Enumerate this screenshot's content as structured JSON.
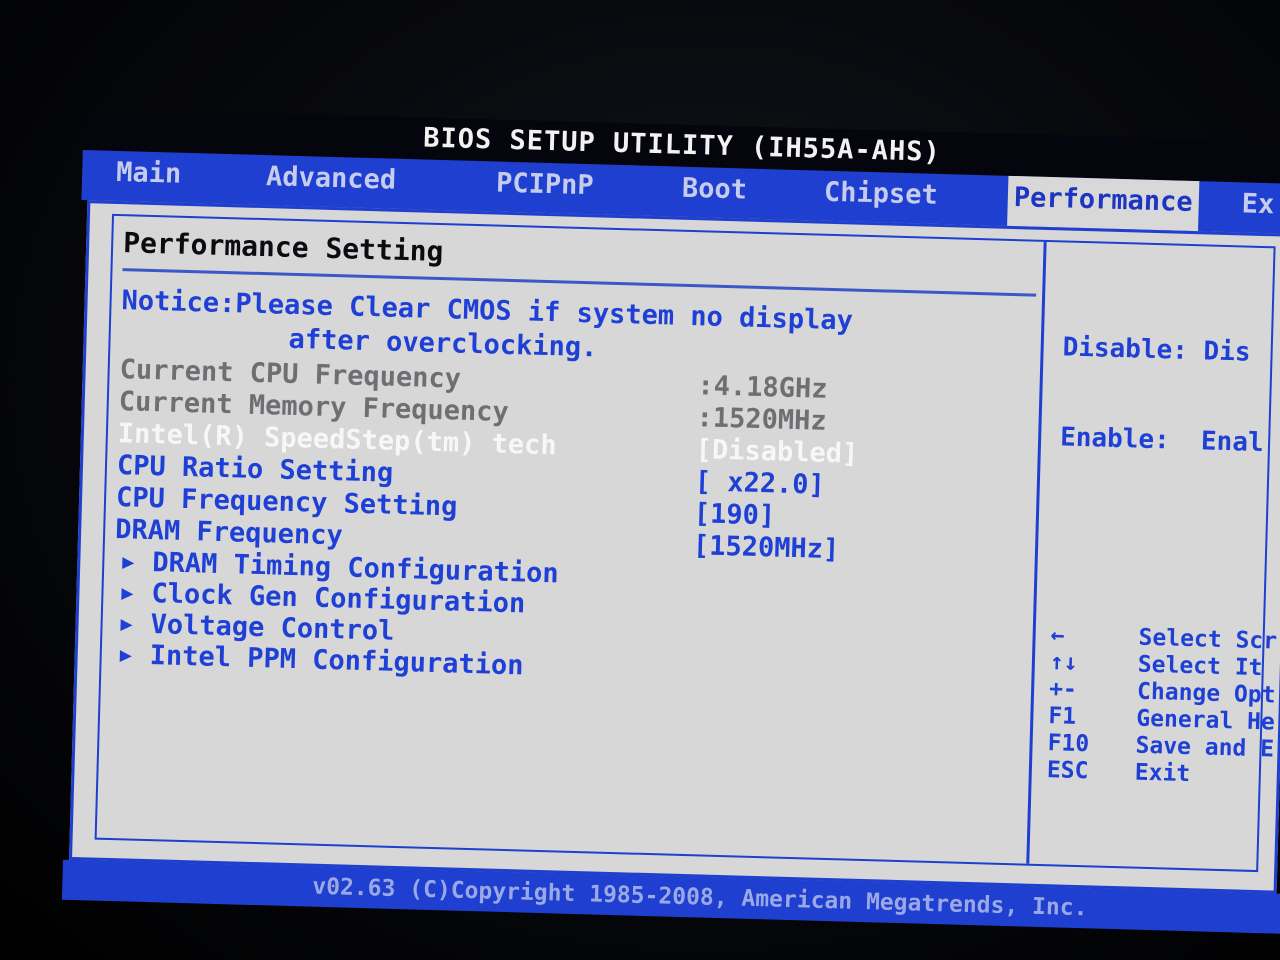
{
  "title": "BIOS SETUP UTILITY (IH55A-AHS)",
  "menu": [
    {
      "label": "Main"
    },
    {
      "label": "Advanced"
    },
    {
      "label": "PCIPnP"
    },
    {
      "label": "Boot"
    },
    {
      "label": "Chipset"
    },
    {
      "label": "Performance",
      "active": true
    },
    {
      "label": "Ex"
    }
  ],
  "section_title": "Performance Setting",
  "notice": {
    "line1": "Notice:Please Clear CMOS if system no display",
    "line2": "after overclocking."
  },
  "settings": [
    {
      "label": "Current CPU Frequency",
      "value": ":4.18GHz",
      "style": "readonly"
    },
    {
      "label": "Current Memory Frequency",
      "value": ":1520MHz",
      "style": "readonly"
    },
    {
      "label": "Intel(R) SpeedStep(tm) tech",
      "value": "[Disabled]",
      "style": "selected"
    },
    {
      "label": "CPU Ratio Setting",
      "value": "[ x22.0]",
      "style": "option"
    },
    {
      "label": "CPU Frequency Setting",
      "value": "[190]",
      "style": "option"
    },
    {
      "label": "DRAM Frequency",
      "value": "[1520MHz]",
      "style": "option"
    }
  ],
  "submenus": [
    {
      "label": "DRAM Timing Configuration"
    },
    {
      "label": "Clock Gen Configuration"
    },
    {
      "label": "Voltage Control"
    },
    {
      "label": "Intel PPM Configuration"
    }
  ],
  "help": {
    "line1": "Disable: Dis",
    "line2": "Enable:  Enal"
  },
  "keys": [
    {
      "key": "←",
      "desc": "Select Scr"
    },
    {
      "key": "↑↓",
      "desc": "Select It"
    },
    {
      "key": "+-",
      "desc": "Change Opt"
    },
    {
      "key": "F1",
      "desc": "General He"
    },
    {
      "key": "F10",
      "desc": "Save and E"
    },
    {
      "key": "ESC",
      "desc": "Exit"
    }
  ],
  "footer": "v02.63 (C)Copyright 1985-2008, American Megatrends, Inc.",
  "colors": {
    "menu_bar": "#1e3fcf",
    "panel": "#d6d7d6",
    "text_blue": "#1f40d6",
    "text_gray": "#6f6f73",
    "text_selected": "#f7f7f7"
  }
}
